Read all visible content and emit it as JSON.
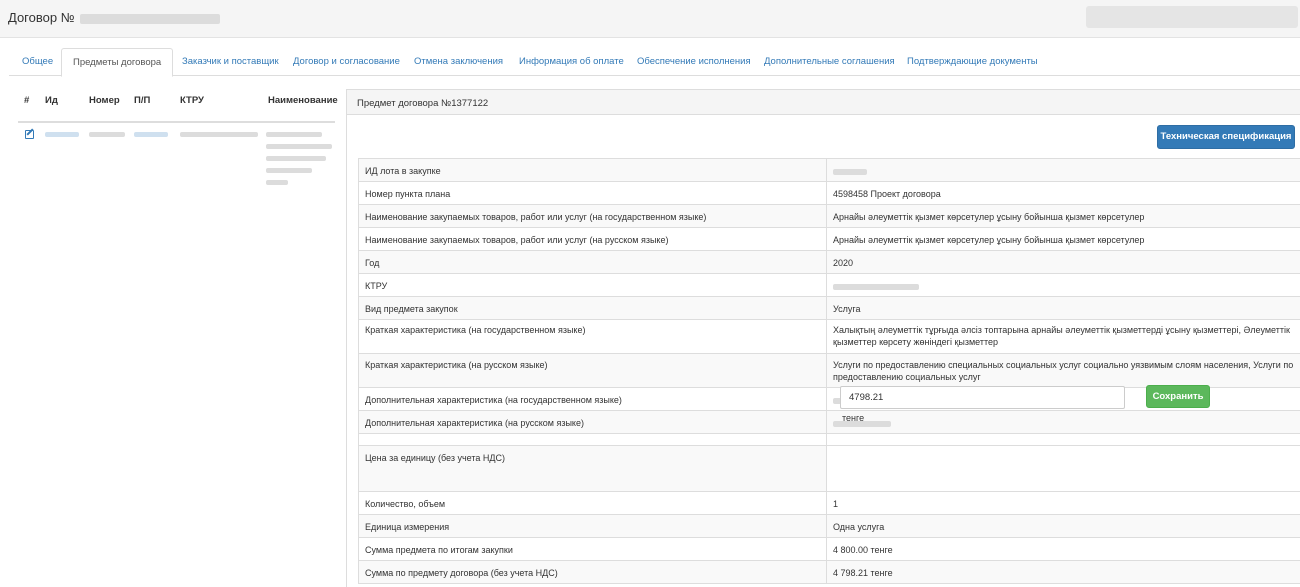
{
  "header": {
    "title_prefix": "Договор №"
  },
  "tabs": [
    {
      "label": "Общее"
    },
    {
      "label": "Предметы договора",
      "active": true
    },
    {
      "label": "Заказчик и поставщик"
    },
    {
      "label": "Договор и согласование"
    },
    {
      "label": "Отмена заключения"
    },
    {
      "label": "Информация об оплате"
    },
    {
      "label": "Обеспечение исполнения"
    },
    {
      "label": "Дополнительные соглашения"
    },
    {
      "label": "Подтверждающие документы"
    }
  ],
  "left_table": {
    "columns": [
      "#",
      "Ид",
      "Номер",
      "П/П",
      "КТРУ",
      "Наименование"
    ]
  },
  "panel": {
    "title": "Предмет договора №1377122",
    "spec_button": "Техническая спецификация",
    "rows": [
      {
        "key": "ИД лота в закупке",
        "value": ""
      },
      {
        "key": "Номер пункта плана",
        "value": "4598458 Проект договора"
      },
      {
        "key": "Наименование закупаемых товаров, работ или услуг (на государственном языке)",
        "value": "Арнайы әлеуметтік қызмет көрсетулер ұсыну бойынша қызмет көрсетулер"
      },
      {
        "key": "Наименование закупаемых товаров, работ или услуг (на русском языке)",
        "value": "Арнайы әлеуметтік қызмет көрсетулер ұсыну бойынша қызмет көрсетулер"
      },
      {
        "key": "Год",
        "value": "2020"
      },
      {
        "key": "КТРУ",
        "value": ""
      },
      {
        "key": "Вид предмета закупок",
        "value": "Услуга"
      },
      {
        "key": "Краткая характеристика (на государственном языке)",
        "value": "Халықтың әлеуметтік тұрғыда әлсіз топтарына арнайы әлеуметтік қызметтерді ұсыну қызметтері, Әлеуметтік қызметтер көрсету жөніндегі қызметтер"
      },
      {
        "key": "Краткая характеристика (на русском языке)",
        "value": "Услуги по предоставлению специальных социальных услуг социально уязвимым слоям населения, Услуги по предоставлению социальных услуг"
      },
      {
        "key": "Дополнительная характеристика (на государственном языке)",
        "value": ""
      },
      {
        "key": "Дополнительная характеристика (на русском языке)",
        "value": ""
      },
      {
        "key": "",
        "value": ""
      },
      {
        "key": "Цена за единицу (без учета НДС)",
        "value": ""
      },
      {
        "key": "Количество, объем",
        "value": "1"
      },
      {
        "key": "Единица измерения",
        "value": "Одна услуга"
      },
      {
        "key": "Сумма предмета по итогам закупки",
        "value": "4 800.00 тенге"
      },
      {
        "key": "Сумма по предмету договора (без учета НДС)",
        "value": "4 798.21 тенге"
      }
    ],
    "price": {
      "value": "4798.21",
      "unit": "тенге",
      "save_label": "Сохранить"
    }
  }
}
